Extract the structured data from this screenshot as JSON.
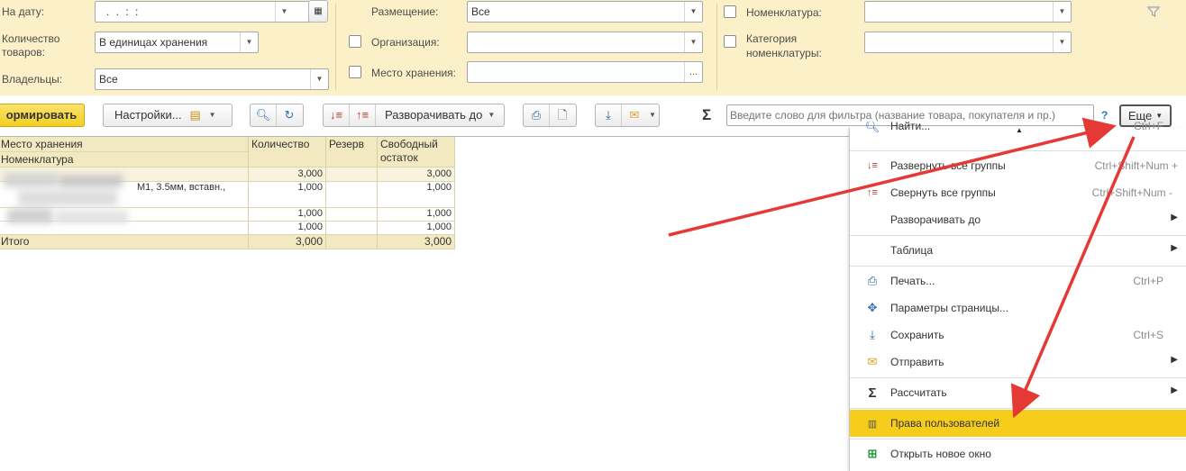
{
  "filters": {
    "na_datu_label": "На дату:",
    "na_datu_value": ". .   : :",
    "kolichestvo_label_1": "Количество",
    "kolichestvo_label_2": "товаров:",
    "kolichestvo_value": "В единицах хранения",
    "vladelcy_label": "Владельцы:",
    "vladelcy_value": "Все",
    "razmeshenie_label": "Размещение:",
    "razmeshenie_value": "Все",
    "organizaciya_label": "Организация:",
    "organizaciya_value": "",
    "mesto_label": "Место хранения:",
    "mesto_value": "",
    "mesto_button": "...",
    "nomenklatura_label": "Номенклатура:",
    "nomenklatura_value": "",
    "kategoriya_label_1": "Категория",
    "kategoriya_label_2": "номенклатуры:",
    "kategoriya_value": ""
  },
  "toolbar": {
    "generate_label": "ормировать",
    "settings_label": "Настройки...",
    "expand_to_label": "Разворачивать до",
    "sigma": "Σ",
    "search_placeholder": "Введите слово для фильтра (название товара, покупателя и пр.)",
    "help": "?",
    "more_label": "Еще"
  },
  "table": {
    "headers": {
      "col1_line1": "Место хранения",
      "col1_line2": "Номенклатура",
      "col2": "Количество",
      "col3": "Резерв",
      "col4_line1": "Свободный",
      "col4_line2": "остаток"
    },
    "rows": [
      {
        "name": "",
        "qty": "3,000",
        "reserve": "",
        "free": "3,000"
      },
      {
        "name": "М1, 3.5мм, вставн.,",
        "qty": "1,000",
        "reserve": "",
        "free": "1,000"
      },
      {
        "name": "",
        "qty": "1,000",
        "reserve": "",
        "free": "1,000"
      },
      {
        "name": "",
        "qty": "1,000",
        "reserve": "",
        "free": "1,000"
      }
    ],
    "total": {
      "label": "Итого",
      "qty": "3,000",
      "reserve": "",
      "free": "3,000"
    }
  },
  "menu": {
    "items": [
      {
        "label": "Найти...",
        "shortcut": "Ctrl+F",
        "icon": "search-icon"
      },
      {
        "label": "Развернуть все группы",
        "shortcut": "Ctrl+Shift+Num +",
        "icon": "expand-groups-icon"
      },
      {
        "label": "Свернуть все группы",
        "shortcut": "Ctrl+Shift+Num -",
        "icon": "collapse-groups-icon"
      },
      {
        "label": "Разворачивать до",
        "shortcut": "",
        "icon": ""
      },
      {
        "label": "Таблица",
        "shortcut": "",
        "icon": ""
      },
      {
        "label": "Печать...",
        "shortcut": "Ctrl+P",
        "icon": "print-icon"
      },
      {
        "label": "Параметры страницы...",
        "shortcut": "",
        "icon": "page-setup-icon"
      },
      {
        "label": "Сохранить",
        "shortcut": "Ctrl+S",
        "icon": "save-icon"
      },
      {
        "label": "Отправить",
        "shortcut": "",
        "icon": "mail-icon"
      },
      {
        "label": "Рассчитать",
        "shortcut": "",
        "icon": "sigma-icon"
      },
      {
        "label": "Права пользователей",
        "shortcut": "",
        "icon": "user-rights-icon"
      },
      {
        "label": "Открыть новое окно",
        "shortcut": "",
        "icon": "new-window-icon"
      }
    ]
  },
  "colors": {
    "filter_bg": "#fbf0c7",
    "generate_button": "#f5d83a",
    "menu_highlight": "#f7cd1c",
    "arrow": "#e53935",
    "table_header": "#f2e9c0"
  }
}
